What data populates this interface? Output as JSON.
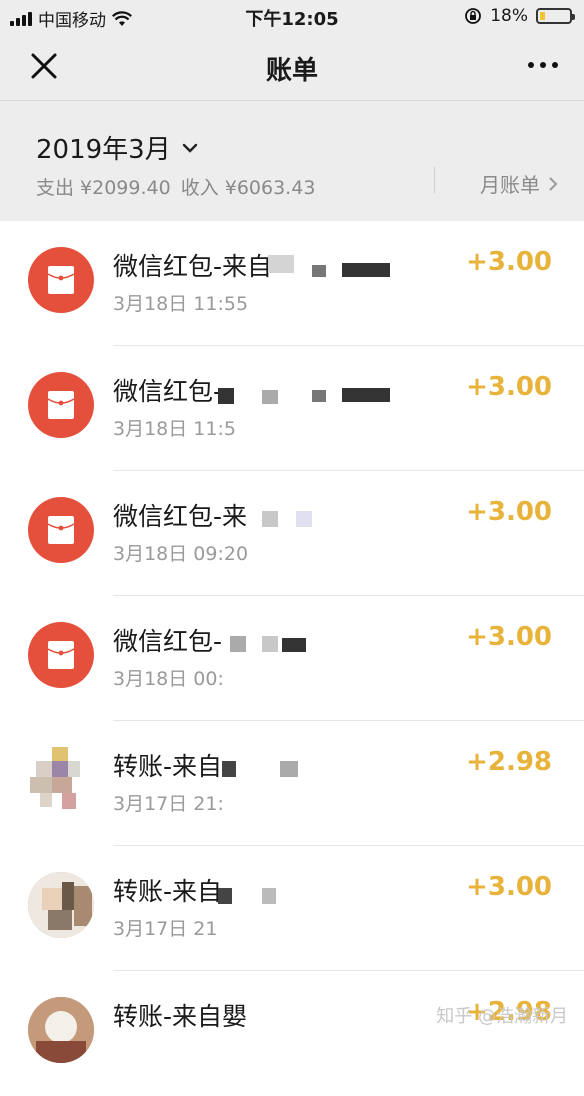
{
  "status_bar": {
    "carrier": "中国移动",
    "time": "下午12:05",
    "battery": "18%",
    "battery_level": 0.18
  },
  "nav": {
    "title": "账单"
  },
  "summary": {
    "month": "2019年3月",
    "expense": "支出 ¥2099.40",
    "income": "收入 ¥6063.43",
    "monthly_bill": "月账单"
  },
  "transactions": [
    {
      "name": "微信红包-来自",
      "date": "3月18日 11:55",
      "amount": "+3.00",
      "icon": "red-packet-icon"
    },
    {
      "name": "微信红包-",
      "date": "3月18日 11:5",
      "amount": "+3.00",
      "icon": "red-packet-icon"
    },
    {
      "name": "微信红包-来",
      "date": "3月18日 09:20",
      "amount": "+3.00",
      "icon": "red-packet-icon"
    },
    {
      "name": "微信红包-",
      "date": "3月18日 00:",
      "amount": "+3.00",
      "icon": "red-packet-icon"
    },
    {
      "name": "转账-来自",
      "date": "3月17日 21:",
      "amount": "+2.98",
      "icon": "avatar"
    },
    {
      "name": "转账-来自",
      "date": "3月17日 21",
      "amount": "+3.00",
      "icon": "avatar"
    },
    {
      "name": "转账-来自嬰",
      "date": "",
      "amount": "+2.98",
      "icon": "avatar"
    }
  ],
  "watermark": "知乎 @浩瀚新月",
  "colors": {
    "accent_amount": "#e8b33a",
    "red_packet": "#e5503c",
    "header_bg": "#ededed"
  }
}
